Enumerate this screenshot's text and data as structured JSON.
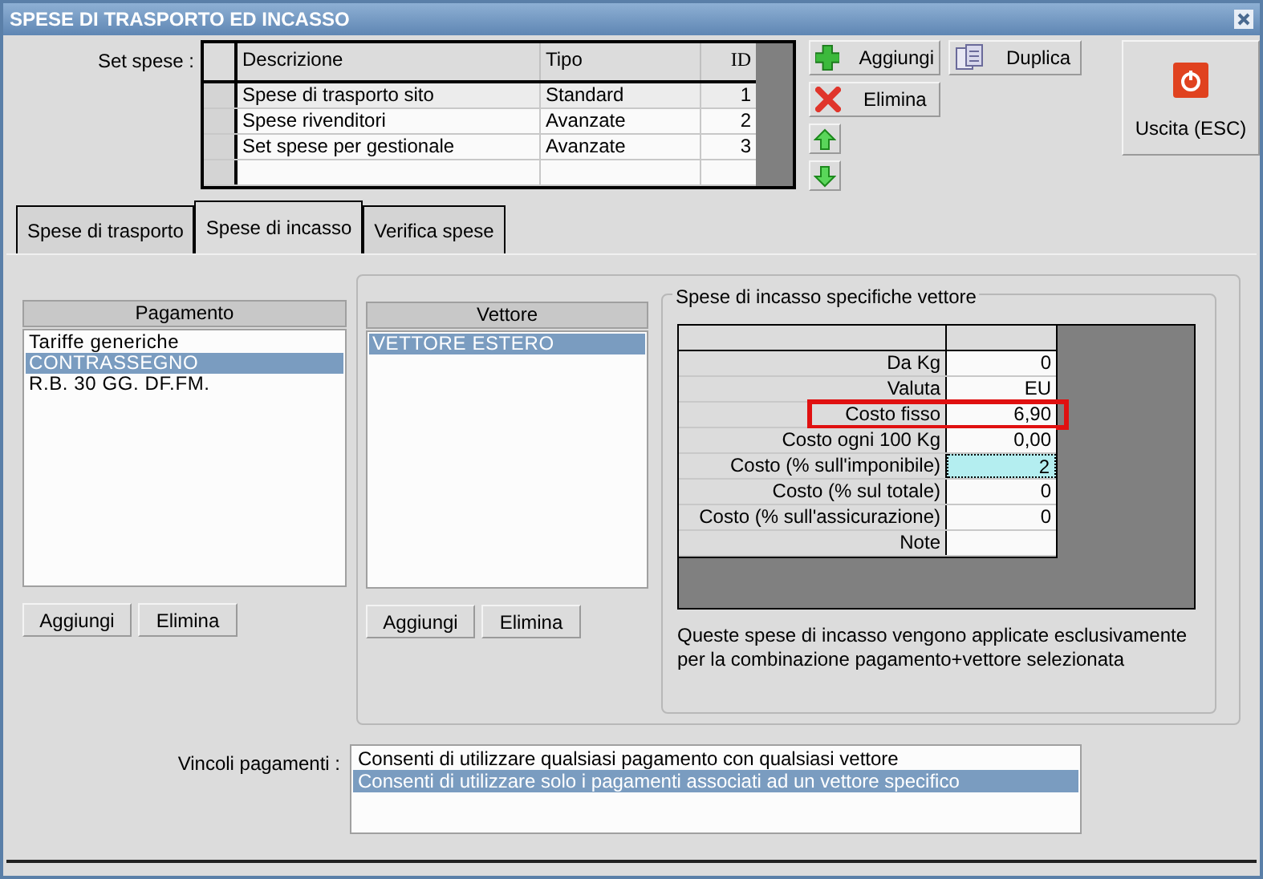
{
  "window": {
    "title": "SPESE DI TRASPORTO ED INCASSO"
  },
  "set_spese": {
    "label": "Set spese :",
    "columns": [
      "Descrizione",
      "Tipo",
      "ID"
    ],
    "rows": [
      {
        "descrizione": "Spese di trasporto sito",
        "tipo": "Standard",
        "id": "1",
        "selected": true
      },
      {
        "descrizione": "Spese rivenditori",
        "tipo": "Avanzate",
        "id": "2",
        "selected": false
      },
      {
        "descrizione": "Set spese per gestionale",
        "tipo": "Avanzate",
        "id": "3",
        "selected": false
      }
    ]
  },
  "toolbar": {
    "add": "Aggiungi",
    "delete": "Elimina",
    "duplicate": "Duplica",
    "exit": "Uscita (ESC)"
  },
  "tabs": [
    {
      "label": "Spese di trasporto",
      "selected": false
    },
    {
      "label": "Spese di incasso",
      "selected": true
    },
    {
      "label": "Verifica spese",
      "selected": false
    }
  ],
  "pagamento": {
    "header": "Pagamento",
    "items": [
      {
        "label": "Tariffe generiche",
        "selected": false
      },
      {
        "label": "CONTRASSEGNO",
        "selected": true
      },
      {
        "label": "R.B. 30 GG. DF.FM.",
        "selected": false
      }
    ],
    "buttons": [
      "Aggiungi",
      "Elimina"
    ]
  },
  "vettore": {
    "header": "Vettore",
    "items": [
      {
        "label": "VETTORE ESTERO",
        "selected": true
      }
    ],
    "buttons": [
      "Aggiungi",
      "Elimina"
    ]
  },
  "spese_incasso": {
    "title": "Spese di incasso specifiche vettore",
    "rows": [
      {
        "label": "Da Kg",
        "value": "0",
        "highlighted": false,
        "focused": false
      },
      {
        "label": "Valuta",
        "value": "EU",
        "highlighted": false,
        "focused": false
      },
      {
        "label": "Costo fisso",
        "value": "6,90",
        "highlighted": true,
        "focused": false
      },
      {
        "label": "Costo ogni 100 Kg",
        "value": "0,00",
        "highlighted": false,
        "focused": false
      },
      {
        "label": "Costo (% sull'imponibile)",
        "value": "2",
        "highlighted": false,
        "focused": true
      },
      {
        "label": "Costo (% sul totale)",
        "value": "0",
        "highlighted": false,
        "focused": false
      },
      {
        "label": "Costo (% sull'assicurazione)",
        "value": "0",
        "highlighted": false,
        "focused": false
      },
      {
        "label": "Note",
        "value": "",
        "highlighted": false,
        "focused": false
      }
    ],
    "note": "Queste spese di incasso vengono applicate esclusivamente per la combinazione pagamento+vettore selezionata"
  },
  "vincoli": {
    "label": "Vincoli pagamenti :",
    "items": [
      {
        "label": "Consenti di utilizzare qualsiasi pagamento con qualsiasi vettore",
        "selected": false
      },
      {
        "label": "Consenti di utilizzare solo i pagamenti associati ad un vettore specifico",
        "selected": true
      }
    ]
  }
}
